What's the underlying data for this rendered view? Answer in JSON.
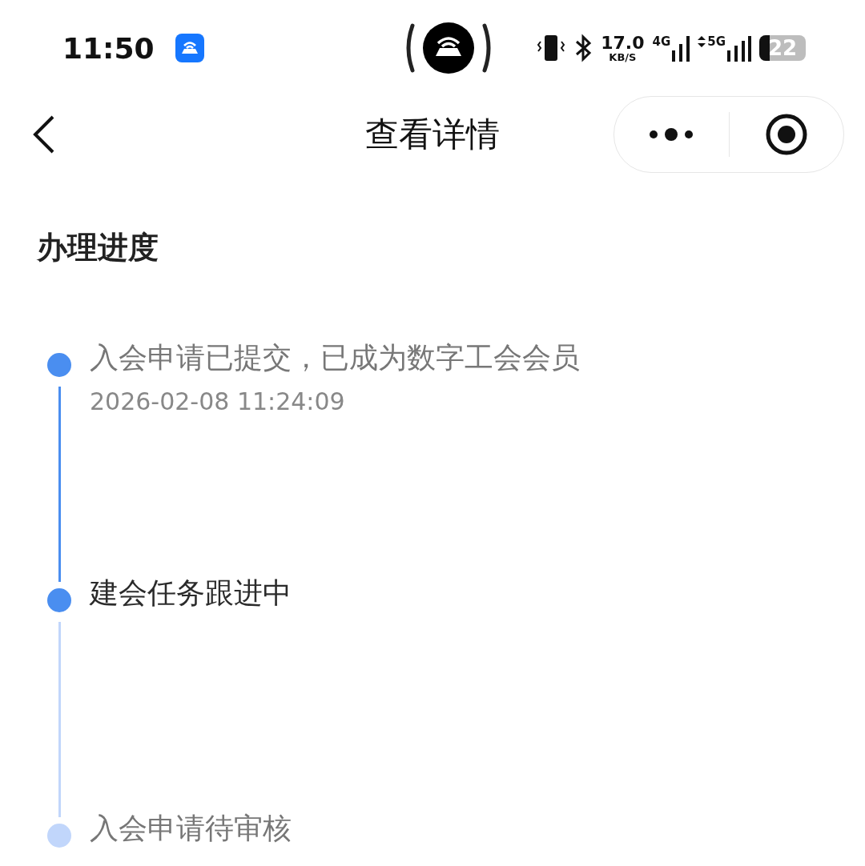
{
  "status_bar": {
    "time": "11:50",
    "speed": "17.0",
    "speed_unit": "KB/S",
    "network_1": "4G",
    "network_2": "5G",
    "battery": "22"
  },
  "nav": {
    "title": "查看详情"
  },
  "section": {
    "title": "办理进度"
  },
  "steps": [
    {
      "title": "入会申请已提交，已成为数字工会会员",
      "time": "2026-02-08 11:24:09",
      "done": true,
      "current": false
    },
    {
      "title": "建会任务跟进中",
      "done": true,
      "current": true
    },
    {
      "title": "入会申请待审核",
      "done": false,
      "current": false
    }
  ]
}
